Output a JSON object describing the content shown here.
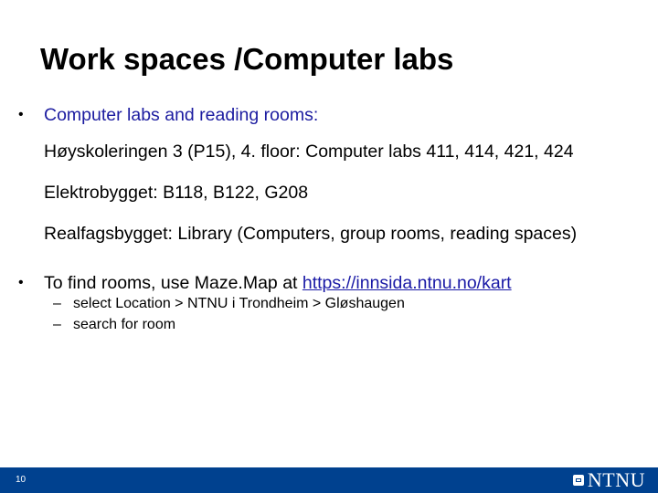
{
  "slide": {
    "title": "Work spaces /Computer labs",
    "page_number": "10"
  },
  "bullets": [
    {
      "marker": "•",
      "text": "Computer labs and reading rooms:",
      "lines": [
        "Høyskoleringen 3 (P15), 4. floor: Computer labs 411, 414, 421, 424",
        "Elektrobygget: B118, B122, G208",
        "Realfagsbygget: Library (Computers, group rooms, reading spaces)"
      ]
    },
    {
      "marker": "•",
      "text": "To find rooms, use Maze.Map at ",
      "link": "https://innsida.ntnu.no/kart",
      "subitems": [
        {
          "marker": "–",
          "text": "select Location > NTNU i Trondheim > Gløshaugen"
        },
        {
          "marker": "–",
          "text": "search for room"
        }
      ]
    }
  ],
  "footer": {
    "logo_text": "NTNU",
    "logo_icon": "ntnu-logo-icon",
    "background_color": "#00418f"
  },
  "colors": {
    "title": "#000000",
    "first_bullet_text": "#1c1ca0",
    "link": "#1a1aa6"
  }
}
